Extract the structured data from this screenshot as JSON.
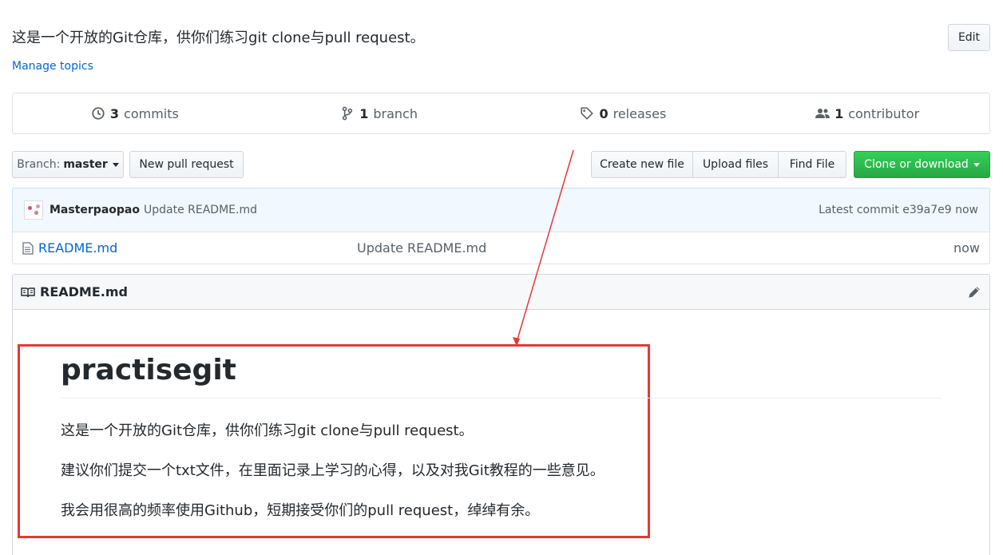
{
  "repo": {
    "description": "这是一个开放的Git仓库，供你们练习git clone与pull request。",
    "manage_topics": "Manage topics",
    "edit_label": "Edit"
  },
  "summary": {
    "commits_count": "3",
    "commits_label": "commits",
    "branch_count": "1",
    "branch_label": "branch",
    "releases_count": "0",
    "releases_label": "releases",
    "contributor_count": "1",
    "contributor_label": "contributor"
  },
  "toolbar": {
    "branch_prefix": "Branch:",
    "branch_name": "master",
    "new_pull_request": "New pull request",
    "create_new_file": "Create new file",
    "upload_files": "Upload files",
    "find_file": "Find File",
    "clone_or_download": "Clone or download"
  },
  "latest_commit": {
    "author": "Masterpaopao",
    "message": "Update README.md",
    "label": "Latest commit",
    "sha": "e39a7e9",
    "age": "now"
  },
  "files": [
    {
      "name": "README.md",
      "message": "Update README.md",
      "age": "now"
    }
  ],
  "readme": {
    "header": "README.md",
    "title": "practisegit",
    "paragraphs": [
      "这是一个开放的Git仓库，供你们练习git clone与pull request。",
      "建议你们提交一个txt文件，在里面记录上学习的心得，以及对我Git教程的一些意见。",
      "我会用很高的频率使用Github，短期接受你们的pull request，绰绰有余。"
    ]
  },
  "icons": {
    "commits": "history-icon",
    "branch": "git-branch-icon",
    "releases": "tag-icon",
    "contributors": "people-icon",
    "file": "file-icon",
    "book": "book-icon",
    "edit": "pencil-icon"
  },
  "colors": {
    "link": "#0366d6",
    "clone_button": "#28a745",
    "annotation": "#e53935"
  }
}
